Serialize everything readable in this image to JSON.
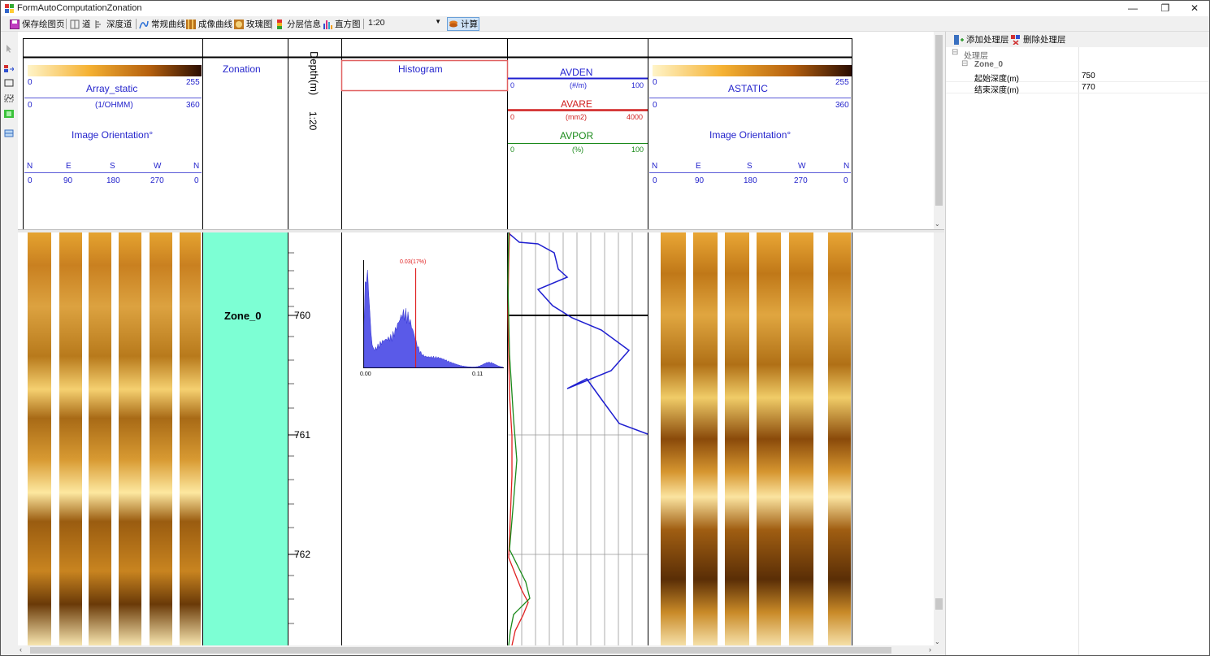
{
  "window": {
    "title": "FormAutoComputationZonation",
    "min": "—",
    "max": "❐",
    "close": "✕"
  },
  "toolbar": {
    "save_label": "保存绘图页",
    "track_label": "道",
    "depth_track_label": "深度道",
    "regular_curve_label": "常规曲线",
    "image_curve_label": "成像曲线",
    "rose_label": "玫瑰图",
    "layer_info_label": "分层信息",
    "histogram_label": "直方图",
    "scale_value": "1:20",
    "calc_label": "计算"
  },
  "tracks": {
    "array": {
      "title": "Array_static",
      "scale_min": "0",
      "scale_max": "255",
      "unit": "(1/OHMM)",
      "unit_min": "0",
      "unit_max": "360",
      "orientation": "Image Orientation°",
      "dirs": [
        "N",
        "E",
        "S",
        "W",
        "N"
      ],
      "degs": [
        "0",
        "90",
        "180",
        "270",
        "0"
      ]
    },
    "zonation": {
      "title": "Zonation",
      "zone_label": "Zone_0"
    },
    "depth": {
      "title": "Depth(m)",
      "scale": "1:20",
      "ticks": [
        "760",
        "761",
        "762"
      ]
    },
    "histogram": {
      "title": "Histogram",
      "marker_label": "0.03(17%)",
      "x_min": "0.00",
      "x_max": "0.11"
    },
    "curves": {
      "avden": {
        "name": "AVDEN",
        "min": "0",
        "unit": "(#/m)",
        "max": "100",
        "color": "#1f1fd0"
      },
      "avare": {
        "name": "AVARE",
        "min": "0",
        "unit": "(mm2)",
        "max": "4000",
        "color": "#e02020"
      },
      "avpor": {
        "name": "AVPOR",
        "min": "0",
        "unit": "(%)",
        "max": "100",
        "color": "#1a8a1a"
      }
    },
    "astatic": {
      "title": "ASTATIC",
      "scale_min": "0",
      "scale_max": "255",
      "unit_min": "0",
      "unit_max": "360",
      "orientation": "Image Orientation°",
      "dirs": [
        "N",
        "E",
        "S",
        "W",
        "N"
      ],
      "degs": [
        "0",
        "90",
        "180",
        "270",
        "0"
      ]
    }
  },
  "side": {
    "add_layer": "添加处理层",
    "delete_layer": "删除处理层",
    "root": "处理层",
    "zone": "Zone_0",
    "props": [
      {
        "name": "起始深度(m)",
        "value": "750"
      },
      {
        "name": "结束深度(m)",
        "value": "770"
      }
    ]
  },
  "colors": {
    "zonation_fill": "#7dffd4",
    "selection_bg": "#cfe3f7"
  }
}
